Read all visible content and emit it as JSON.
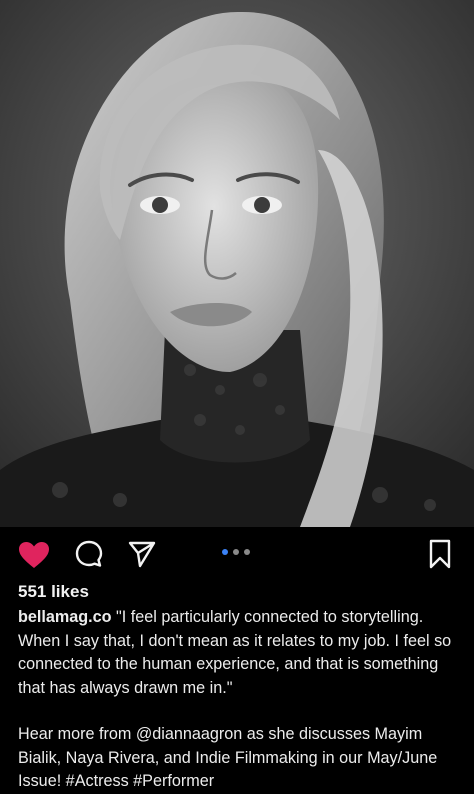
{
  "post": {
    "photo": "black-and-white portrait",
    "likes": "551 likes",
    "username": "bellamag.co",
    "caption_line1": " \"I feel particularly connected to storytelling. When I say that, I don't mean as it relates to my job. I feel so connected to the human experience, and that is something that has always drawn me in.\"",
    "caption_line2": "Hear more from @diannaagron as she discusses Mayim Bialik, Naya Rivera, and Indie Filmmaking in our May/June Issue!  #Actress #Performer"
  },
  "actions": {
    "icons": [
      "heart-icon",
      "comment-icon",
      "share-icon",
      "bookmark-icon"
    ],
    "like_color": "#e0245e",
    "carousel_dots": 3,
    "carousel_active": 1
  }
}
